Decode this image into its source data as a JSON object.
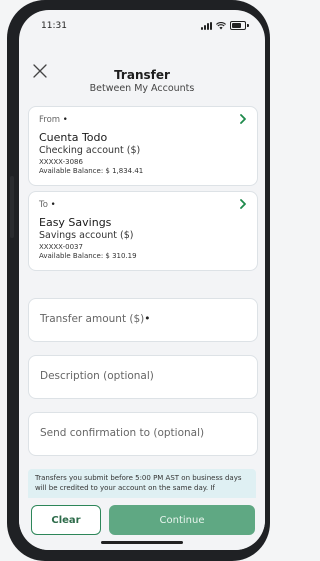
{
  "status_bar": {
    "time": "11:31"
  },
  "header": {
    "title": "Transfer",
    "subtitle": "Between My Accounts"
  },
  "from_card": {
    "label": "From",
    "required_mark": "•",
    "name": "Cuenta Todo",
    "type": "Checking account ($)",
    "account_number": "XXXXX-3086",
    "balance": "Available Balance: $ 1,834.41"
  },
  "to_card": {
    "label": "To",
    "required_mark": "•",
    "name": "Easy Savings",
    "type": "Savings account ($)",
    "account_number": "XXXXX-0037",
    "balance": "Available Balance: $ 310.19"
  },
  "fields": {
    "amount_placeholder": "Transfer amount ($)",
    "amount_required_mark": "•",
    "description_placeholder": "Description (optional)",
    "confirmation_placeholder": "Send confirmation to (optional)"
  },
  "notice": {
    "text": "Transfers you submit before 5:00 PM AST on business days will be credited to your account on the same day. If"
  },
  "actions": {
    "clear_label": "Clear",
    "continue_label": "Continue"
  },
  "colors": {
    "accent": "#2d8659",
    "continue_bg": "#5fa883",
    "notice_bg": "#dff0f3"
  }
}
